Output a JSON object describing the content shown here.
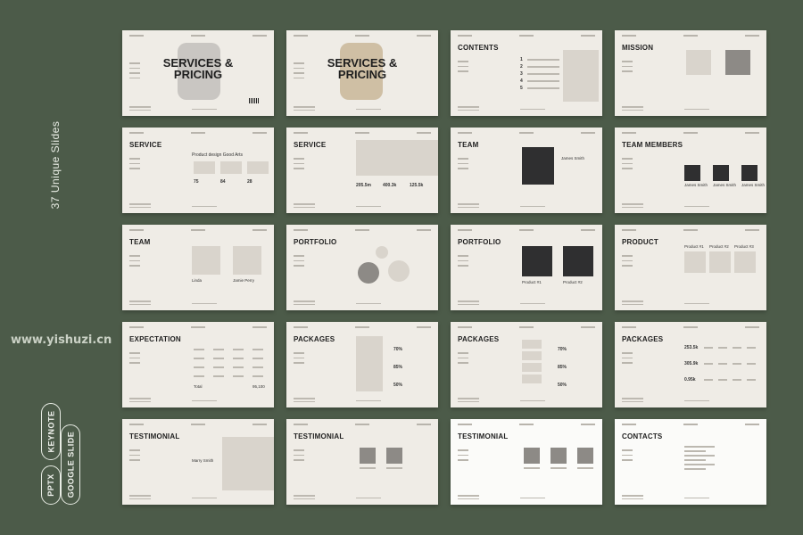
{
  "side_label": "37 Unique Slides",
  "watermark": "www.yishuzi.cn",
  "formats": [
    "PPTX",
    "KEYNOTE",
    "GOOGLE SLIDE"
  ],
  "colors": {
    "background": "#4c5b49",
    "slide": "#efece6",
    "slide_white": "#fbfbf9"
  },
  "slides": [
    {
      "title": "SERVICES &\nPRICING",
      "layout": "cover"
    },
    {
      "title": "SERVICES &\nPRICING",
      "layout": "cover"
    },
    {
      "title": "CONTENTS",
      "layout": "contents"
    },
    {
      "title": "MISSION",
      "layout": "mission"
    },
    {
      "title": "SERVICE",
      "layout": "service1"
    },
    {
      "title": "SERVICE",
      "layout": "service2"
    },
    {
      "title": "TEAM",
      "layout": "team1"
    },
    {
      "title": "TEAM MEMBERS",
      "layout": "members"
    },
    {
      "title": "TEAM",
      "layout": "team2"
    },
    {
      "title": "PORTFOLIO",
      "layout": "portfolio1"
    },
    {
      "title": "PORTFOLIO",
      "layout": "portfolio2"
    },
    {
      "title": "PRODUCT",
      "layout": "product"
    },
    {
      "title": "EXPECTATION",
      "layout": "expectation"
    },
    {
      "title": "PACKAGES",
      "layout": "packages1"
    },
    {
      "title": "PACKAGES",
      "layout": "packages2"
    },
    {
      "title": "PACKAGES",
      "layout": "packages3"
    },
    {
      "title": "TESTIMONIAL",
      "layout": "testimonial1"
    },
    {
      "title": "TESTIMONIAL",
      "layout": "testimonial2"
    },
    {
      "title": "TESTIMONIAL",
      "layout": "testimonial3"
    },
    {
      "title": "CONTACTS",
      "layout": "contacts"
    }
  ],
  "small_text": {
    "service1_heading": "Product design Good Arts",
    "service1_stats": [
      "75",
      "84",
      "28"
    ],
    "service2_stats": [
      "205.5m",
      "400.3k",
      "125.5k"
    ],
    "team1_name": "James Smith",
    "members_name": "James Smith",
    "team2_names": [
      "Linda",
      "Jamie Perry"
    ],
    "portfolio2_labels": [
      "Product #1",
      "Product #2"
    ],
    "product_labels": [
      "Product #1",
      "Product #2",
      "Product #3"
    ],
    "expectation_total": "Total",
    "expectation_value": "95,100",
    "packages_pct": [
      "70%",
      "85%",
      "50%"
    ],
    "packages3_values": [
      "253.5k",
      "305.9k",
      "0.95k"
    ],
    "testimonial_name": "Marry Smith"
  }
}
